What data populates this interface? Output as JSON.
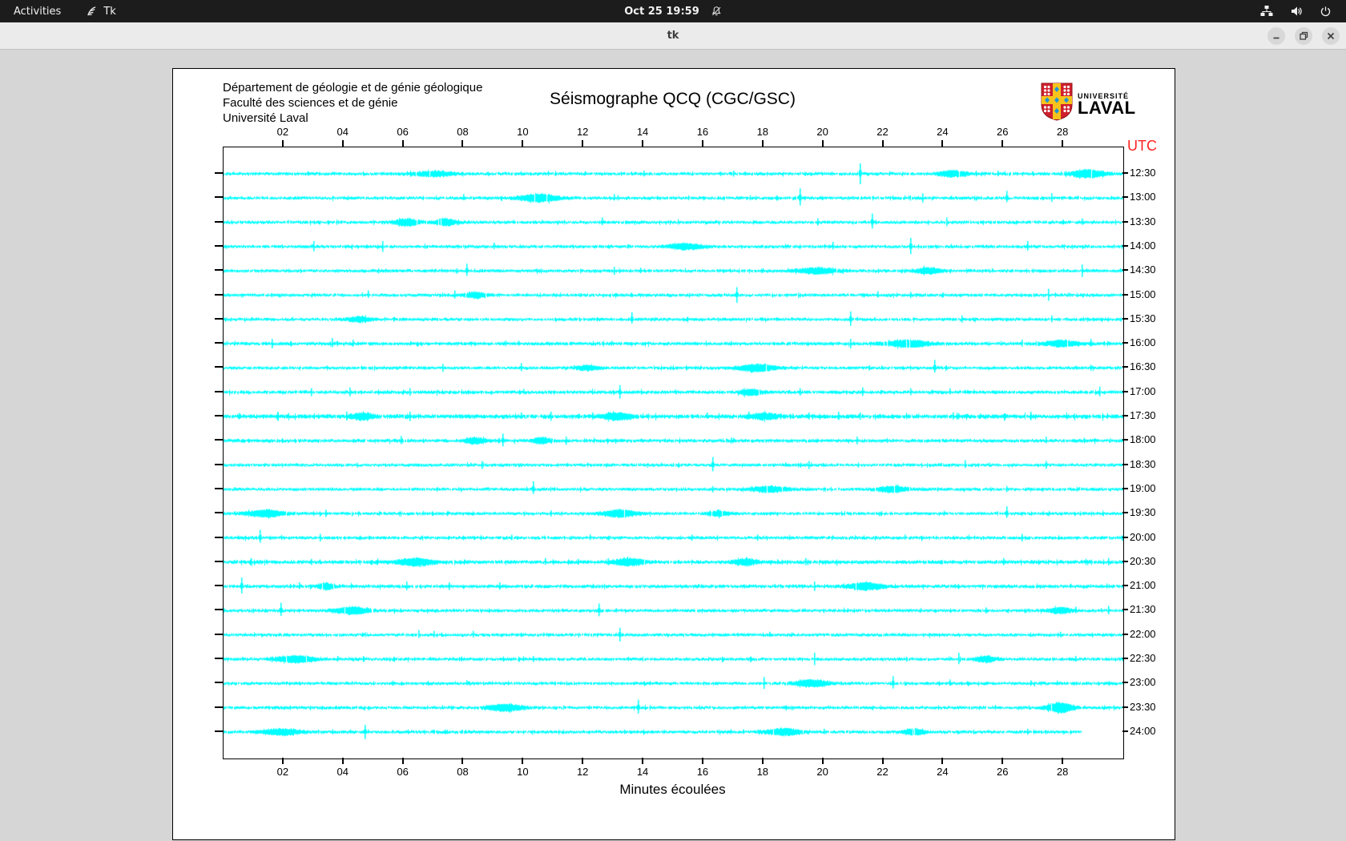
{
  "top_bar": {
    "activities": "Activities",
    "app_indicator": "Tk",
    "clock": "Oct 25 19:59"
  },
  "window": {
    "title": "tk"
  },
  "seismograph": {
    "header_lines": [
      "Département de géologie et de génie géologique",
      "Faculté des sciences et de génie",
      "Université Laval"
    ],
    "title": "Séismographe QCQ (CGC/GSC)",
    "utc_label": "UTC",
    "xlabel": "Minutes écoulées",
    "logo": {
      "line1": "UNIVERSITÉ",
      "line2": "LAVAL"
    },
    "colors": {
      "trace": "#00ffff",
      "utc": "#ff2020",
      "logo_red": "#cf1f2c",
      "logo_yellow": "#f6c31c",
      "logo_blue": "#2095d5"
    }
  },
  "chart_data": {
    "type": "line",
    "title": "Séismographe QCQ (CGC/GSC)",
    "xlabel": "Minutes écoulées",
    "x_range_minutes": [
      0,
      30
    ],
    "x_tick_labels": [
      "02",
      "04",
      "06",
      "08",
      "10",
      "12",
      "14",
      "16",
      "18",
      "20",
      "22",
      "24",
      "26",
      "28"
    ],
    "utc_axis_label": "UTC",
    "rows": [
      {
        "label": "12:30",
        "noise": 1.0,
        "end_minute": 30,
        "spikes": [
          [
            14.0,
            4
          ],
          [
            17.0,
            4
          ],
          [
            21.2,
            13
          ],
          [
            25.8,
            4
          ]
        ],
        "blobs": [
          [
            7.0,
            1.0,
            2.5
          ],
          [
            24.3,
            0.7,
            3
          ],
          [
            28.8,
            0.8,
            4
          ]
        ]
      },
      {
        "label": "13:00",
        "noise": 1.0,
        "end_minute": 30,
        "spikes": [
          [
            8.0,
            5
          ],
          [
            13.0,
            5
          ],
          [
            19.2,
            12
          ],
          [
            23.3,
            6
          ],
          [
            26.1,
            9
          ],
          [
            27.6,
            6
          ]
        ],
        "blobs": [
          [
            10.5,
            0.9,
            4
          ]
        ]
      },
      {
        "label": "13:30",
        "noise": 1.0,
        "end_minute": 30,
        "spikes": [
          [
            12.6,
            6
          ],
          [
            19.8,
            5
          ],
          [
            21.6,
            11
          ],
          [
            24.1,
            6
          ],
          [
            28.6,
            5
          ]
        ],
        "blobs": [
          [
            6.1,
            0.6,
            3.5
          ],
          [
            7.4,
            0.5,
            3.5
          ]
        ]
      },
      {
        "label": "14:00",
        "noise": 1.0,
        "end_minute": 30,
        "spikes": [
          [
            3.0,
            7
          ],
          [
            5.3,
            7
          ],
          [
            9.0,
            5
          ],
          [
            15.3,
            5
          ],
          [
            20.3,
            6
          ],
          [
            22.9,
            11
          ],
          [
            26.8,
            7
          ]
        ],
        "blobs": [
          [
            15.4,
            0.8,
            3
          ]
        ]
      },
      {
        "label": "14:30",
        "noise": 1.0,
        "end_minute": 30,
        "spikes": [
          [
            8.1,
            9
          ],
          [
            13.0,
            5
          ],
          [
            13.9,
            4
          ],
          [
            28.6,
            8
          ]
        ],
        "blobs": [
          [
            19.8,
            0.9,
            3
          ],
          [
            23.5,
            0.6,
            3
          ]
        ]
      },
      {
        "label": "15:00",
        "noise": 1.0,
        "end_minute": 30,
        "spikes": [
          [
            4.8,
            6
          ],
          [
            7.7,
            6
          ],
          [
            17.1,
            10
          ],
          [
            21.8,
            5
          ],
          [
            22.9,
            4
          ],
          [
            27.5,
            8
          ]
        ],
        "blobs": [
          [
            8.4,
            0.5,
            3
          ]
        ]
      },
      {
        "label": "15:30",
        "noise": 1.0,
        "end_minute": 30,
        "spikes": [
          [
            13.6,
            9
          ],
          [
            20.9,
            10
          ],
          [
            24.6,
            5
          ],
          [
            27.6,
            5
          ]
        ],
        "blobs": [
          [
            4.5,
            0.6,
            2.5
          ]
        ]
      },
      {
        "label": "16:00",
        "noise": 1.1,
        "end_minute": 30,
        "spikes": [
          [
            1.6,
            6
          ],
          [
            3.6,
            7
          ],
          [
            4.3,
            5
          ],
          [
            20.9,
            6
          ],
          [
            26.6,
            5
          ],
          [
            28.9,
            6
          ]
        ],
        "blobs": [
          [
            22.8,
            1.0,
            3.5
          ],
          [
            27.9,
            0.8,
            3
          ]
        ]
      },
      {
        "label": "16:30",
        "noise": 1.0,
        "end_minute": 30,
        "spikes": [
          [
            7.3,
            5
          ],
          [
            9.9,
            6
          ],
          [
            23.7,
            10
          ],
          [
            28.9,
            4
          ]
        ],
        "blobs": [
          [
            12.1,
            0.5,
            2.5
          ],
          [
            17.8,
            0.9,
            3.5
          ]
        ]
      },
      {
        "label": "17:00",
        "noise": 1.1,
        "end_minute": 30,
        "spikes": [
          [
            2.9,
            5
          ],
          [
            4.2,
            6
          ],
          [
            6.2,
            5
          ],
          [
            10.0,
            4
          ],
          [
            13.2,
            9
          ],
          [
            19.2,
            5
          ],
          [
            21.3,
            6
          ],
          [
            22.9,
            5
          ],
          [
            24.2,
            5
          ],
          [
            29.2,
            7
          ]
        ],
        "blobs": [
          [
            17.6,
            0.5,
            3
          ]
        ]
      },
      {
        "label": "17:30",
        "noise": 1.4,
        "end_minute": 30,
        "spikes": [
          [
            1.8,
            6
          ],
          [
            4.1,
            6
          ],
          [
            6.2,
            6
          ],
          [
            9.9,
            5
          ],
          [
            10.9,
            6
          ],
          [
            12.3,
            5
          ],
          [
            16.1,
            5
          ],
          [
            17.5,
            6
          ],
          [
            19.5,
            5
          ],
          [
            20.5,
            6
          ],
          [
            21.2,
            5
          ],
          [
            24.3,
            5
          ],
          [
            26.9,
            6
          ]
        ],
        "blobs": [
          [
            4.6,
            0.5,
            3
          ],
          [
            13.1,
            0.7,
            3
          ],
          [
            18.0,
            0.6,
            3
          ]
        ]
      },
      {
        "label": "18:00",
        "noise": 1.1,
        "end_minute": 30,
        "spikes": [
          [
            5.9,
            6
          ],
          [
            9.3,
            9
          ],
          [
            11.4,
            5
          ],
          [
            16.9,
            4
          ],
          [
            21.1,
            5
          ],
          [
            27.4,
            5
          ]
        ],
        "blobs": [
          [
            8.4,
            0.5,
            3
          ],
          [
            10.6,
            0.4,
            3
          ]
        ]
      },
      {
        "label": "18:30",
        "noise": 1.0,
        "end_minute": 30,
        "spikes": [
          [
            8.6,
            5
          ],
          [
            16.3,
            10
          ],
          [
            19.5,
            5
          ],
          [
            24.7,
            6
          ],
          [
            27.4,
            5
          ]
        ],
        "blobs": []
      },
      {
        "label": "19:00",
        "noise": 1.0,
        "end_minute": 30,
        "spikes": [
          [
            10.3,
            10
          ],
          [
            16.3,
            4
          ],
          [
            26.1,
            4
          ]
        ],
        "blobs": [
          [
            18.2,
            0.8,
            3
          ],
          [
            22.3,
            0.7,
            3
          ]
        ]
      },
      {
        "label": "19:30",
        "noise": 1.0,
        "end_minute": 30,
        "spikes": [
          [
            3.4,
            5
          ],
          [
            10.9,
            4
          ],
          [
            26.1,
            9
          ]
        ],
        "blobs": [
          [
            1.4,
            0.9,
            3.5
          ],
          [
            13.2,
            0.8,
            3.5
          ],
          [
            16.5,
            0.5,
            2.5
          ]
        ]
      },
      {
        "label": "20:00",
        "noise": 1.0,
        "end_minute": 30,
        "spikes": [
          [
            1.2,
            10
          ],
          [
            3.2,
            5
          ],
          [
            9.6,
            4
          ],
          [
            12.2,
            4
          ],
          [
            15.6,
            4
          ],
          [
            17.8,
            4
          ],
          [
            22.7,
            4
          ],
          [
            26.6,
            5
          ]
        ],
        "blobs": []
      },
      {
        "label": "20:30",
        "noise": 1.2,
        "end_minute": 30,
        "spikes": [
          [
            0.9,
            5
          ],
          [
            2.9,
            4
          ],
          [
            10.7,
            5
          ],
          [
            11.8,
            4
          ],
          [
            19.4,
            5
          ],
          [
            26.0,
            5
          ],
          [
            29.5,
            5
          ]
        ],
        "blobs": [
          [
            6.4,
            0.8,
            3.5
          ],
          [
            13.5,
            0.7,
            3.5
          ],
          [
            17.4,
            0.5,
            3
          ]
        ]
      },
      {
        "label": "21:00",
        "noise": 1.1,
        "end_minute": 30,
        "spikes": [
          [
            0.6,
            11
          ],
          [
            2.5,
            5
          ],
          [
            6.1,
            6
          ],
          [
            7.5,
            5
          ],
          [
            9.2,
            5
          ],
          [
            19.7,
            6
          ]
        ],
        "blobs": [
          [
            3.4,
            0.4,
            3
          ],
          [
            21.4,
            0.8,
            3.5
          ]
        ]
      },
      {
        "label": "21:30",
        "noise": 1.0,
        "end_minute": 30,
        "spikes": [
          [
            1.9,
            10
          ],
          [
            12.5,
            9
          ],
          [
            25.4,
            4
          ],
          [
            28.4,
            5
          ],
          [
            29.5,
            6
          ]
        ],
        "blobs": [
          [
            4.3,
            0.8,
            3.5
          ],
          [
            27.9,
            0.5,
            3
          ]
        ]
      },
      {
        "label": "22:00",
        "noise": 1.0,
        "end_minute": 30,
        "spikes": [
          [
            6.5,
            6
          ],
          [
            7.0,
            5
          ],
          [
            8.3,
            5
          ],
          [
            13.2,
            9
          ],
          [
            18.2,
            4
          ],
          [
            27.9,
            4
          ]
        ],
        "blobs": []
      },
      {
        "label": "22:30",
        "noise": 1.0,
        "end_minute": 30,
        "spikes": [
          [
            3.8,
            4
          ],
          [
            10.3,
            4
          ],
          [
            19.7,
            8
          ],
          [
            24.5,
            8
          ],
          [
            28.4,
            4
          ]
        ],
        "blobs": [
          [
            2.4,
            0.9,
            3.5
          ],
          [
            25.4,
            0.5,
            3
          ]
        ]
      },
      {
        "label": "23:00",
        "noise": 1.0,
        "end_minute": 30,
        "spikes": [
          [
            8.1,
            4
          ],
          [
            18.0,
            8
          ],
          [
            22.3,
            9
          ],
          [
            24.2,
            5
          ],
          [
            26.9,
            4
          ]
        ],
        "blobs": [
          [
            19.6,
            0.8,
            3.5
          ]
        ]
      },
      {
        "label": "23:30",
        "noise": 1.0,
        "end_minute": 30,
        "spikes": [
          [
            13.8,
            10
          ]
        ],
        "blobs": [
          [
            9.4,
            0.8,
            3.5
          ],
          [
            27.9,
            0.6,
            5
          ]
        ]
      },
      {
        "label": "24:00",
        "noise": 1.0,
        "end_minute": 28.6,
        "spikes": [
          [
            4.7,
            9
          ],
          [
            20.0,
            4
          ],
          [
            26.8,
            4
          ]
        ],
        "blobs": [
          [
            1.9,
            0.9,
            3
          ],
          [
            18.7,
            0.8,
            3.5
          ],
          [
            23.0,
            0.5,
            3
          ]
        ]
      }
    ]
  }
}
